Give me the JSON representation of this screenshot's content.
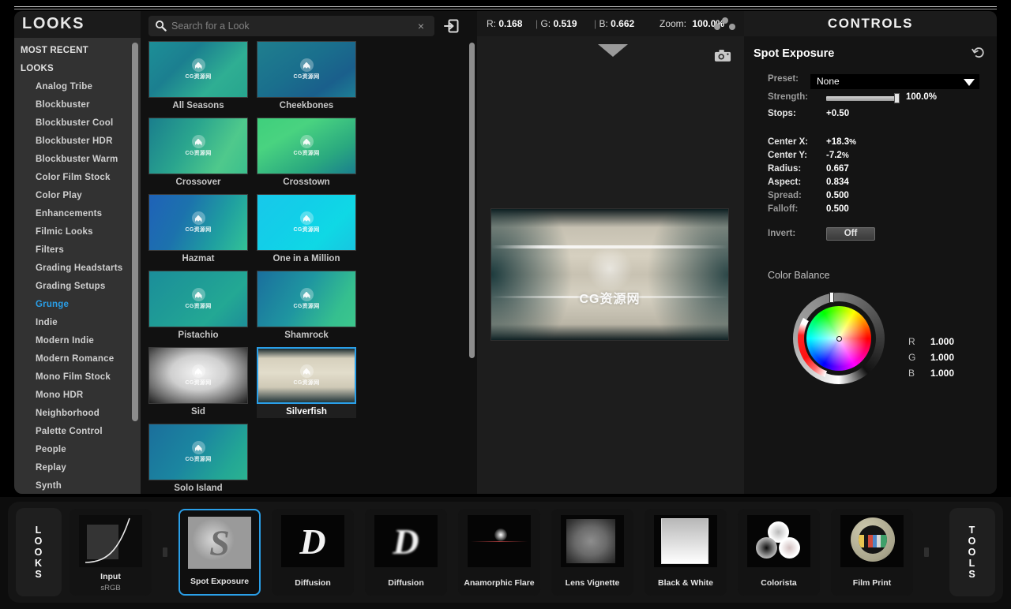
{
  "sidebar": {
    "title": "LOOKS",
    "items": [
      {
        "label": "MOST RECENT",
        "type": "group",
        "selected": false
      },
      {
        "label": "LOOKS",
        "type": "group",
        "selected": false
      },
      {
        "label": "Analog Tribe",
        "type": "child",
        "selected": false
      },
      {
        "label": "Blockbuster",
        "type": "child",
        "selected": false
      },
      {
        "label": "Blockbuster Cool",
        "type": "child",
        "selected": false
      },
      {
        "label": "Blockbuster HDR",
        "type": "child",
        "selected": false
      },
      {
        "label": "Blockbuster Warm",
        "type": "child",
        "selected": false
      },
      {
        "label": "Color Film Stock",
        "type": "child",
        "selected": false
      },
      {
        "label": "Color Play",
        "type": "child",
        "selected": false
      },
      {
        "label": "Enhancements",
        "type": "child",
        "selected": false
      },
      {
        "label": "Filmic Looks",
        "type": "child",
        "selected": false
      },
      {
        "label": "Filters",
        "type": "child",
        "selected": false
      },
      {
        "label": "Grading Headstarts",
        "type": "child",
        "selected": false
      },
      {
        "label": "Grading Setups",
        "type": "child",
        "selected": false
      },
      {
        "label": "Grunge",
        "type": "child",
        "selected": true
      },
      {
        "label": "Indie",
        "type": "child",
        "selected": false
      },
      {
        "label": "Modern Indie",
        "type": "child",
        "selected": false
      },
      {
        "label": "Modern Romance",
        "type": "child",
        "selected": false
      },
      {
        "label": "Mono Film Stock",
        "type": "child",
        "selected": false
      },
      {
        "label": "Mono HDR",
        "type": "child",
        "selected": false
      },
      {
        "label": "Neighborhood",
        "type": "child",
        "selected": false
      },
      {
        "label": "Palette Control",
        "type": "child",
        "selected": false
      },
      {
        "label": "People",
        "type": "child",
        "selected": false
      },
      {
        "label": "Replay",
        "type": "child",
        "selected": false
      },
      {
        "label": "Synth",
        "type": "child",
        "selected": false
      }
    ]
  },
  "browser": {
    "search": {
      "placeholder": "Search for a Look",
      "value": "",
      "clear_label": "×",
      "search_icon": "search-icon",
      "import_icon": "import-look-icon"
    },
    "looks": [
      {
        "name": "All Seasons",
        "selected": false,
        "watermark": "CG资源网",
        "gradient": "linear-gradient(135deg,#1d8f97 0%,#1b7f90 35%,#2fae93 70%,#27a58e 100%)"
      },
      {
        "name": "Cheekbones",
        "selected": false,
        "watermark": "CG资源网",
        "gradient": "linear-gradient(145deg,#1f7f8f 0%,#1a6f8d 45%,#1a5f8c 75%,#1d7f95 100%)"
      },
      {
        "name": "Crossover",
        "selected": false,
        "watermark": "CG资源网",
        "gradient": "linear-gradient(120deg,#1a7e8d 0%,#2aa58e 40%,#4fc98c 75%,#3bbf8d 100%)"
      },
      {
        "name": "Crosstown",
        "selected": false,
        "watermark": "CG资源网",
        "gradient": "linear-gradient(150deg,#3fcf7c 0%,#49d380 30%,#2aa97f 70%,#1a7f8e 100%)"
      },
      {
        "name": "Hazmat",
        "selected": false,
        "watermark": "CG资源网",
        "gradient": "linear-gradient(115deg,#1f62b8 0%,#1c72ad 35%,#1f9fa0 70%,#33c297 100%)"
      },
      {
        "name": "One in a Million",
        "selected": false,
        "watermark": "CG资源网",
        "gradient": "linear-gradient(135deg,#18c8ea 0%,#12cfe8 40%,#0fd8e5 70%,#17c6e0 100%)"
      },
      {
        "name": "Pistachio",
        "selected": false,
        "watermark": "CG资源网",
        "gradient": "linear-gradient(135deg,#1b8e9a 0%,#1f9c96 40%,#23a894 70%,#1d8f98 100%)"
      },
      {
        "name": "Shamrock",
        "selected": false,
        "watermark": "CG资源网",
        "gradient": "linear-gradient(120deg,#1a6f9e 0%,#1f96a0 45%,#35bf8f 80%,#3cc78c 100%)"
      },
      {
        "name": "Sid",
        "selected": false,
        "watermark": "CG资源网",
        "gradient": "radial-gradient(ellipse at 50% 45%, #f4f4f4 0%, #cfcfcf 40%, #6a6a6a 75%, #1b1b1b 100%)"
      },
      {
        "name": "Silverfish",
        "selected": true,
        "watermark": "CG资源网",
        "gradient": "linear-gradient(to bottom,#1b2b2e 0%,#d6d0bd 18%,#e2ddcb 45%,#cfc9b6 72%,#23363a 100%)"
      },
      {
        "name": "Solo Island",
        "selected": false,
        "watermark": "CG资源网",
        "gradient": "linear-gradient(125deg,#1b6f9c 0%,#1b86a0 45%,#23a795 80%,#2bb291 100%)"
      }
    ]
  },
  "viewer": {
    "readout": {
      "r_label": "R:",
      "r_value": "0.168",
      "g_label": "G:",
      "g_value": "0.519",
      "b_label": "B:",
      "b_value": "0.662",
      "zoom_label": "Zoom:",
      "zoom_value": "100.0%",
      "separator": "|"
    },
    "dots_icon": "three-dots-icon",
    "camera_icon": "camera-snapshot-icon",
    "chevron_icon": "chevron-down-icon",
    "preview_watermark": "CG资源网"
  },
  "controls": {
    "title": "CONTROLS",
    "module_name": "Spot Exposure",
    "reset_icon": "reset-icon",
    "preset": {
      "label": "Preset:",
      "value": "None",
      "caret_icon": "chevron-down-icon"
    },
    "strength": {
      "label": "Strength:",
      "value": "100.0%",
      "percent": 100
    },
    "params": [
      {
        "label": "Stops:",
        "value": "+0.50",
        "dim": false
      },
      {
        "label": "Center X:",
        "value": "+18.3",
        "unit": "%",
        "dim": false
      },
      {
        "label": "Center Y:",
        "value": "-7.2",
        "unit": "%",
        "dim": false
      },
      {
        "label": "Radius:",
        "value": "0.667",
        "dim": false
      },
      {
        "label": "Aspect:",
        "value": "0.834",
        "dim": false
      },
      {
        "label": "Spread:",
        "value": "0.500",
        "dim": true
      },
      {
        "label": "Falloff:",
        "value": "0.500",
        "dim": true
      }
    ],
    "invert": {
      "label": "Invert:",
      "value": "Off"
    },
    "color_balance": {
      "title": "Color Balance",
      "r_key": "R",
      "r_value": "1.000",
      "g_key": "G",
      "g_value": "1.000",
      "b_key": "B",
      "b_value": "1.000"
    }
  },
  "bottom": {
    "left_tab": {
      "letters": [
        "L",
        "O",
        "O",
        "K",
        "S"
      ]
    },
    "right_tab": {
      "letters": [
        "T",
        "O",
        "O",
        "L",
        "S"
      ]
    },
    "tiles": [
      {
        "name": "Input",
        "sublabel": "sRGB",
        "selected": false,
        "art": "curve"
      },
      {
        "name": "Spot Exposure",
        "sublabel": "",
        "selected": true,
        "art": "spot"
      },
      {
        "name": "Diffusion",
        "sublabel": "",
        "selected": false,
        "art": "d-bold"
      },
      {
        "name": "Diffusion",
        "sublabel": "",
        "selected": false,
        "art": "d-soft"
      },
      {
        "name": "Anamorphic Flare",
        "sublabel": "",
        "selected": false,
        "art": "flare"
      },
      {
        "name": "Lens Vignette",
        "sublabel": "",
        "selected": false,
        "art": "vignette"
      },
      {
        "name": "Black & White",
        "sublabel": "",
        "selected": false,
        "art": "bw"
      },
      {
        "name": "Colorista",
        "sublabel": "",
        "selected": false,
        "art": "colorista"
      },
      {
        "name": "Film Print",
        "sublabel": "",
        "selected": false,
        "art": "film"
      }
    ]
  },
  "theme": {
    "accent": "#2a9fe8",
    "panel_bg": "#141414",
    "sidebar_bg": "#323232",
    "text": "#e6e6e6"
  }
}
